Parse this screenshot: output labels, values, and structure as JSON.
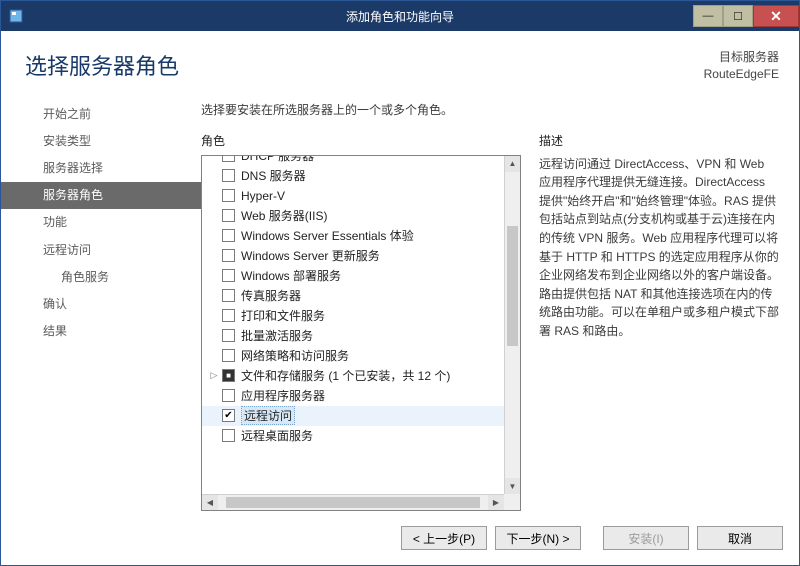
{
  "window": {
    "title": "添加角色和功能向导"
  },
  "header": {
    "page_title": "选择服务器角色",
    "target_label": "目标服务器",
    "target_server": "RouteEdgeFE"
  },
  "sidebar": {
    "items": [
      {
        "label": "开始之前"
      },
      {
        "label": "安装类型"
      },
      {
        "label": "服务器选择"
      },
      {
        "label": "服务器角色",
        "selected": true
      },
      {
        "label": "功能"
      },
      {
        "label": "远程访问"
      },
      {
        "label": "角色服务",
        "indent": true
      },
      {
        "label": "确认"
      },
      {
        "label": "结果"
      }
    ]
  },
  "main": {
    "instruction": "选择要安装在所选服务器上的一个或多个角色。",
    "roles_heading": "角色",
    "desc_heading": "描述",
    "description": "远程访问通过 DirectAccess、VPN 和 Web 应用程序代理提供无缝连接。DirectAccess 提供\"始终开启\"和\"始终管理\"体验。RAS 提供包括站点到站点(分支机构或基于云)连接在内的传统 VPN 服务。Web 应用程序代理可以将基于 HTTP 和 HTTPS 的选定应用程序从你的企业网络发布到企业网络以外的客户端设备。路由提供包括 NAT 和其他连接选项在内的传统路由功能。可以在单租户或多租户模式下部署 RAS 和路由。",
    "roles": [
      {
        "label": "DHCP 服务器",
        "state": "unchecked",
        "top_cut": true
      },
      {
        "label": "DNS 服务器",
        "state": "unchecked"
      },
      {
        "label": "Hyper-V",
        "state": "unchecked"
      },
      {
        "label": "Web 服务器(IIS)",
        "state": "unchecked"
      },
      {
        "label": "Windows Server Essentials 体验",
        "state": "unchecked"
      },
      {
        "label": "Windows Server 更新服务",
        "state": "unchecked"
      },
      {
        "label": "Windows 部署服务",
        "state": "unchecked"
      },
      {
        "label": "传真服务器",
        "state": "unchecked"
      },
      {
        "label": "打印和文件服务",
        "state": "unchecked"
      },
      {
        "label": "批量激活服务",
        "state": "unchecked"
      },
      {
        "label": "网络策略和访问服务",
        "state": "unchecked"
      },
      {
        "label": "文件和存储服务 (1 个已安装，共 12 个)",
        "state": "mixed",
        "expandable": true
      },
      {
        "label": "应用程序服务器",
        "state": "unchecked"
      },
      {
        "label": "远程访问",
        "state": "checked",
        "selected": true
      },
      {
        "label": "远程桌面服务",
        "state": "unchecked"
      }
    ]
  },
  "footer": {
    "prev": "< 上一步(P)",
    "next": "下一步(N) >",
    "install": "安装(I)",
    "cancel": "取消"
  }
}
